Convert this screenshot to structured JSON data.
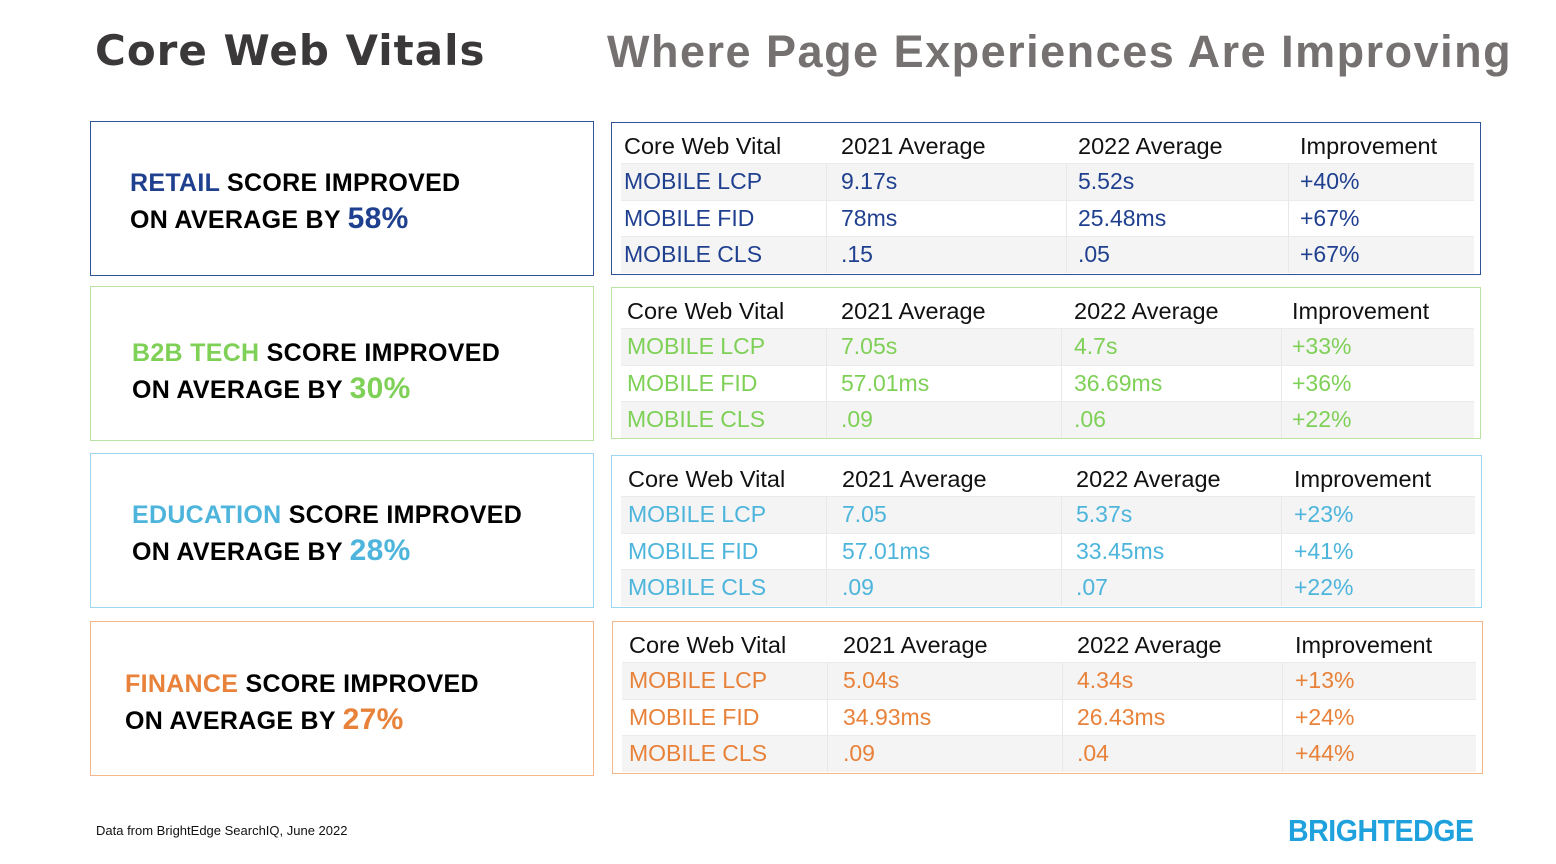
{
  "header": {
    "title": "Core Web Vitals",
    "subtitle": "Where Page Experiences Are Improving"
  },
  "table_headers": [
    "Core Web Vital",
    "2021 Average",
    "2022 Average",
    "Improvement"
  ],
  "industries": [
    {
      "name": "RETAIL",
      "line1_suffix": " SCORE IMPROVED",
      "line2_prefix": "ON AVERAGE BY ",
      "improvement": "58%",
      "accent_color": "#1f3f8f",
      "border_color": "#2f5597",
      "rows": [
        {
          "metric": "MOBILE LCP",
          "avg_2021": "9.17s",
          "avg_2022": "5.52s",
          "improvement": "+40%"
        },
        {
          "metric": "MOBILE FID",
          "avg_2021": "78ms",
          "avg_2022": "25.48ms",
          "improvement": "+67%"
        },
        {
          "metric": "MOBILE CLS",
          "avg_2021": ".15",
          "avg_2022": ".05",
          "improvement": "+67%"
        }
      ]
    },
    {
      "name": "B2B TECH",
      "line1_suffix": " SCORE IMPROVED",
      "line2_prefix": "ON AVERAGE BY ",
      "improvement": "30%",
      "accent_color": "#7ed057",
      "border_color": "#b9e3a2",
      "rows": [
        {
          "metric": "MOBILE LCP",
          "avg_2021": "7.05s",
          "avg_2022": "4.7s",
          "improvement": "+33%"
        },
        {
          "metric": "MOBILE FID",
          "avg_2021": "57.01ms",
          "avg_2022": "36.69ms",
          "improvement": "+36%"
        },
        {
          "metric": "MOBILE CLS",
          "avg_2021": ".09",
          "avg_2022": ".06",
          "improvement": "+22%"
        }
      ]
    },
    {
      "name": "EDUCATION",
      "line1_suffix": " SCORE IMPROVED",
      "line2_prefix": "ON AVERAGE BY ",
      "improvement": "28%",
      "accent_color": "#4db5dc",
      "border_color": "#9fd6ef",
      "rows": [
        {
          "metric": "MOBILE LCP",
          "avg_2021": "7.05",
          "avg_2022": "5.37s",
          "improvement": "+23%"
        },
        {
          "metric": "MOBILE FID",
          "avg_2021": "57.01ms",
          "avg_2022": "33.45ms",
          "improvement": "+41%"
        },
        {
          "metric": "MOBILE CLS",
          "avg_2021": ".09",
          "avg_2022": ".07",
          "improvement": "+22%"
        }
      ]
    },
    {
      "name": "FINANCE",
      "line1_suffix": " SCORE IMPROVED",
      "line2_prefix": "ON AVERAGE BY ",
      "improvement": "27%",
      "accent_color": "#e8823a",
      "border_color": "#f4b68a",
      "rows": [
        {
          "metric": "MOBILE LCP",
          "avg_2021": "5.04s",
          "avg_2022": "4.34s",
          "improvement": "+13%"
        },
        {
          "metric": "MOBILE FID",
          "avg_2021": "34.93ms",
          "avg_2022": "26.43ms",
          "improvement": "+24%"
        },
        {
          "metric": "MOBILE CLS",
          "avg_2021": ".09",
          "avg_2022": ".04",
          "improvement": "+44%"
        }
      ]
    }
  ],
  "footer": {
    "source_note": "Data from BrightEdge SearchIQ, June 2022",
    "logo_text": "BRIGHTEDGE"
  }
}
